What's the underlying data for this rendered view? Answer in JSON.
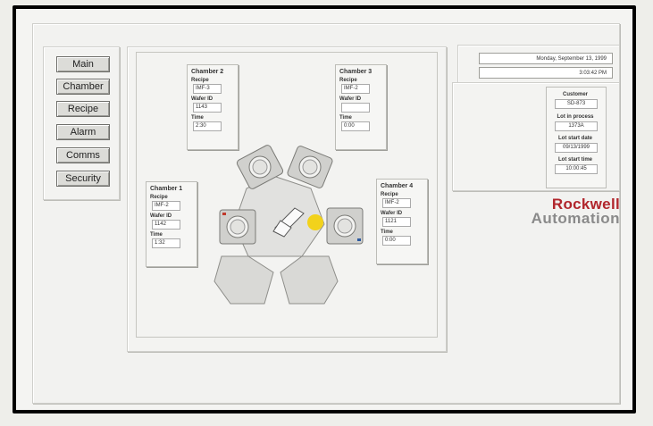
{
  "nav": {
    "items": [
      "Main",
      "Chamber",
      "Recipe",
      "Alarm",
      "Comms",
      "Security"
    ]
  },
  "chambers": {
    "chamber2": {
      "title": "Chamber 2",
      "recipe_label": "Recipe",
      "recipe": "IMF-3",
      "wafer_label": "Wafer ID",
      "wafer": "1143",
      "time_label": "Time",
      "time": "2:30"
    },
    "chamber3": {
      "title": "Chamber 3",
      "recipe_label": "Recipe",
      "recipe": "IMF-2",
      "wafer_label": "Wafer ID",
      "wafer": "",
      "time_label": "Time",
      "time": "0:00"
    },
    "chamber1": {
      "title": "Chamber 1",
      "recipe_label": "Recipe",
      "recipe": "IMF-2",
      "wafer_label": "Wafer ID",
      "wafer": "1142",
      "time_label": "Time",
      "time": "1:32"
    },
    "chamber4": {
      "title": "Chamber 4",
      "recipe_label": "Recipe",
      "recipe": "IMF-2",
      "wafer_label": "Wafer ID",
      "wafer": "1121",
      "time_label": "Time",
      "time": "0:00"
    }
  },
  "datetime": {
    "date": "Monday, September 13, 1999",
    "time": "3:03:42 PM"
  },
  "info": {
    "customer_label": "Customer",
    "customer": "SD-873",
    "lot_label": "Lot in process",
    "lot": "1373A",
    "start_date_label": "Lot start date",
    "start_date": "09/13/1999",
    "start_time_label": "Lot start time",
    "start_time": "10:00:45"
  },
  "brand": {
    "line1": "Rockwell",
    "line2": "Automation"
  },
  "colors": {
    "brand_red": "#b1262c",
    "brand_gray": "#8a8a8a",
    "wafer_indicator": "#f2d21b"
  }
}
